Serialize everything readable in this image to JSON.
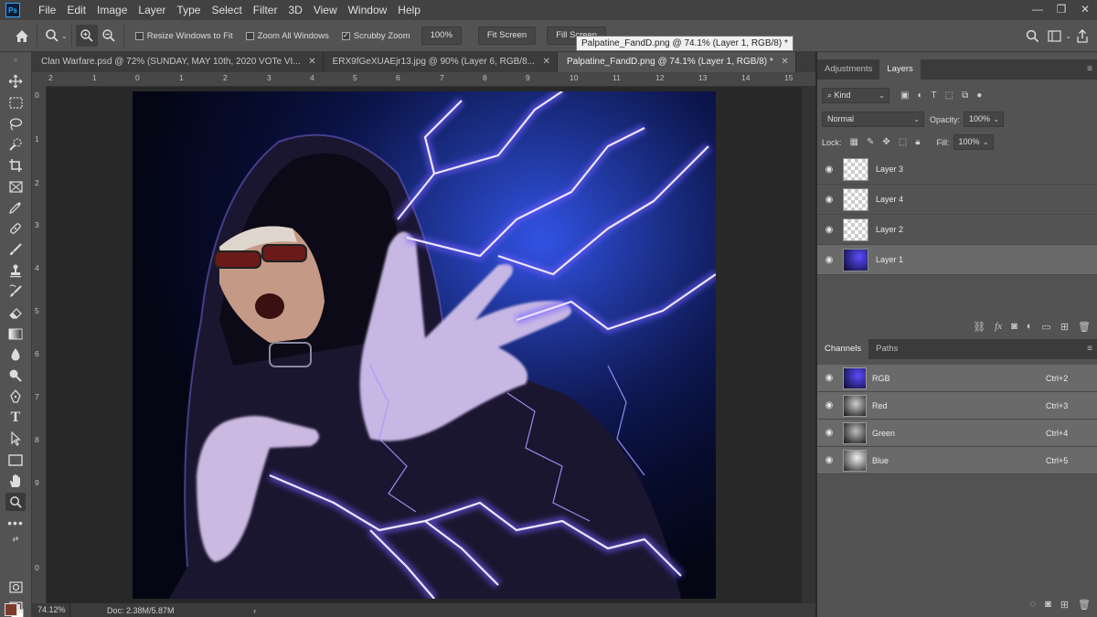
{
  "app": {
    "logo": "Ps"
  },
  "menu": [
    "File",
    "Edit",
    "Image",
    "Layer",
    "Type",
    "Select",
    "Filter",
    "3D",
    "View",
    "Window",
    "Help"
  ],
  "window_controls": {
    "minimize": "—",
    "restore": "❐",
    "close": "✕"
  },
  "options_bar": {
    "resize_windows": "Resize Windows to Fit",
    "zoom_all": "Zoom All Windows",
    "scrubby_zoom": "Scrubby Zoom",
    "zoom_level": "100%",
    "fit_screen": "Fit Screen",
    "fill_screen": "Fill Screen",
    "checks": {
      "resize_windows": false,
      "zoom_all": false,
      "scrubby_zoom": true
    }
  },
  "tooltip": "Palpatine_FandD.png @ 74.1% (Layer 1, RGB/8) *",
  "tabs": [
    {
      "label": "Clan Warfare.psd @ 72% (SUNDAY, MAY 10th, 2020 VOTe VI...",
      "active": false
    },
    {
      "label": "ERX9fGeXUAEjr13.jpg @ 90% (Layer 6, RGB/8...",
      "active": false
    },
    {
      "label": "Palpatine_FandD.png @ 74.1% (Layer 1, RGB/8) *",
      "active": true
    }
  ],
  "ruler": {
    "h": [
      "2",
      "1",
      "0",
      "1",
      "2",
      "3",
      "4",
      "5",
      "6",
      "7",
      "8",
      "9",
      "10",
      "11",
      "12",
      "13",
      "14",
      "15"
    ],
    "v": [
      "0",
      "1",
      "2",
      "3",
      "4",
      "5",
      "6",
      "7",
      "8",
      "9",
      "0"
    ]
  },
  "status": {
    "zoom": "74.12%",
    "doc": "Doc: 2.38M/5.87M",
    "arrow": "›"
  },
  "layers_panel": {
    "tabs": [
      "Adjustments",
      "Layers"
    ],
    "active_tab": "Layers",
    "kind": "Kind",
    "blend_mode": "Normal",
    "opacity_label": "Opacity:",
    "opacity": "100%",
    "lock_label": "Lock:",
    "fill_label": "Fill:",
    "fill": "100%",
    "layers": [
      {
        "name": "Layer 3",
        "selected": false
      },
      {
        "name": "Layer 4",
        "selected": false
      },
      {
        "name": "Layer 2",
        "selected": false
      },
      {
        "name": "Layer 1",
        "selected": true
      }
    ]
  },
  "channels_panel": {
    "tabs": [
      "Channels",
      "Paths"
    ],
    "active_tab": "Channels",
    "channels": [
      {
        "name": "RGB",
        "shortcut": "Ctrl+2"
      },
      {
        "name": "Red",
        "shortcut": "Ctrl+3"
      },
      {
        "name": "Green",
        "shortcut": "Ctrl+4"
      },
      {
        "name": "Blue",
        "shortcut": "Ctrl+5"
      }
    ]
  },
  "colors": {
    "accent": "#31a8ff",
    "foreground": "#7b3b2a",
    "background": "#ffffff",
    "lightning": "#b8a8ff"
  },
  "icons": {
    "home": "⌂",
    "zoom": "🔍",
    "search": "⌕",
    "eye": "👁"
  }
}
